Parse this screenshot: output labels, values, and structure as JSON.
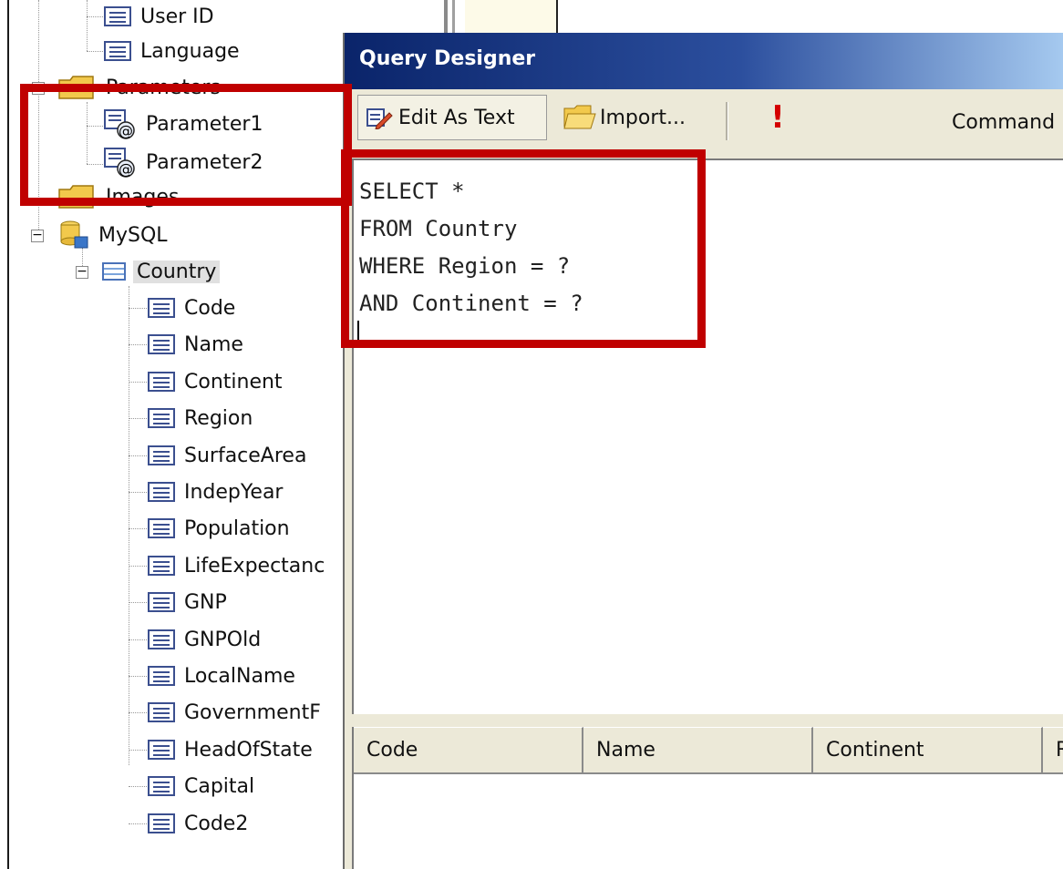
{
  "tree": {
    "top_fields": [
      "User ID",
      "Language"
    ],
    "parameters_folder": "Parameters",
    "parameters": [
      "Parameter1",
      "Parameter2"
    ],
    "images_folder": "Images",
    "data_source": "MySQL",
    "table": "Country",
    "fields": [
      "Code",
      "Name",
      "Continent",
      "Region",
      "SurfaceArea",
      "IndepYear",
      "Population",
      "LifeExpectanc",
      "GNP",
      "GNPOld",
      "LocalName",
      "GovernmentF",
      "HeadOfState",
      "Capital",
      "Code2"
    ]
  },
  "dialog": {
    "title": "Query Designer",
    "toolbar": {
      "edit_as_text": "Edit As Text",
      "import": "Import...",
      "run": "!",
      "command_label": "Command"
    },
    "sql": "SELECT *\nFROM Country\nWHERE Region = ?\nAND Continent = ?",
    "result_columns": [
      "Code",
      "Name",
      "Continent",
      "R"
    ]
  },
  "colors": {
    "highlight": "#c00000",
    "titlebar_start": "#0a246a",
    "titlebar_end": "#a6caf0"
  },
  "icons": {
    "field": "field-icon",
    "parameter": "parameter-icon",
    "folder": "folder-icon",
    "database": "database-icon",
    "table": "table-icon",
    "edit": "edit-text-icon",
    "import": "folder-open-icon",
    "run": "exclamation-icon"
  }
}
